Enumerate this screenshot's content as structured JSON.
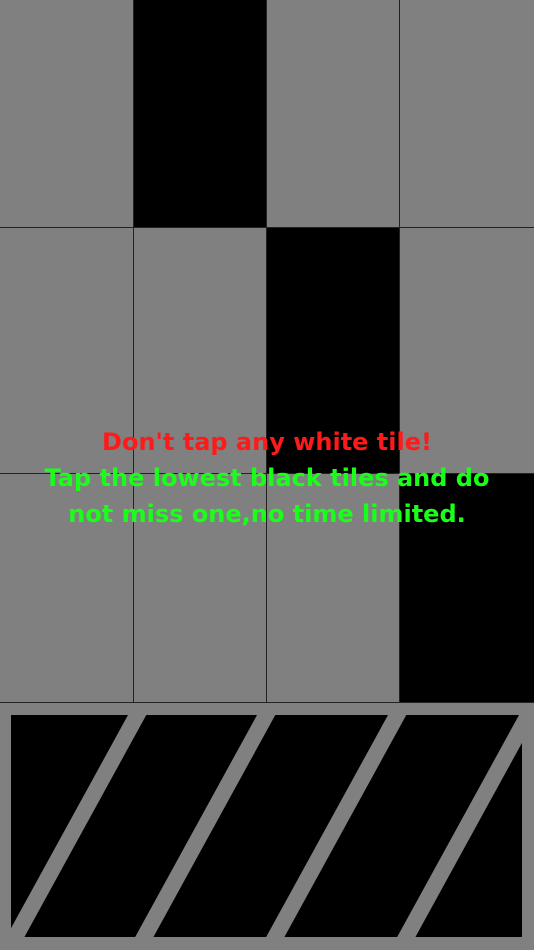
{
  "game": {
    "rows": [
      [
        "white",
        "black",
        "white",
        "white"
      ],
      [
        "white",
        "white",
        "black",
        "white"
      ],
      [
        "white",
        "white",
        "white",
        "black"
      ]
    ],
    "colors": {
      "white_tile": "#808080",
      "black_tile": "#000000",
      "grid_line": "#222222",
      "warning_text": "#ff1a1a",
      "hint_text": "#1aff1a"
    }
  },
  "instructions": {
    "line1": "Don't tap any white tile!",
    "line2": "Tap the lowest black tiles and do",
    "line3": "not miss one,no time limited."
  }
}
